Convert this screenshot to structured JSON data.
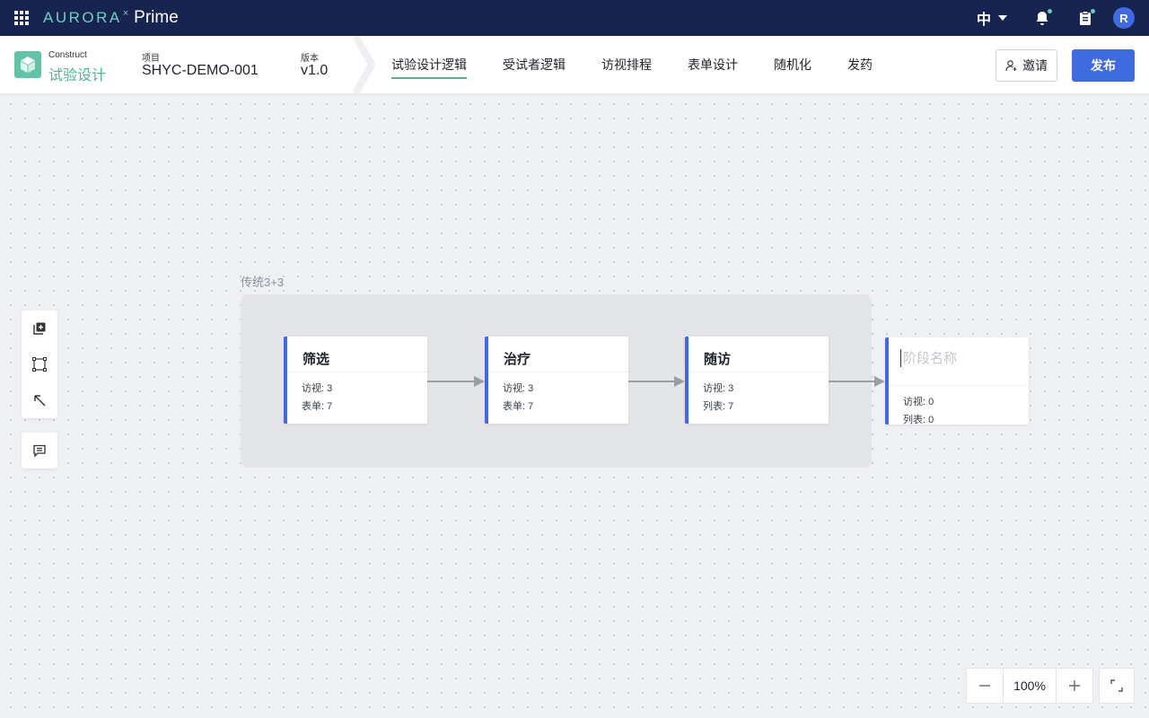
{
  "topbar": {
    "brand_name": "AURORA",
    "brand_mark": "×",
    "product_name": "Prime",
    "language": "中",
    "user_initial": "R",
    "icons": [
      "apps-grid-icon",
      "bell-icon",
      "clipboard-icon",
      "avatar"
    ]
  },
  "header": {
    "module_sub": "Construct",
    "module_title": "试验设计",
    "project_label": "项目",
    "project_value": "SHYC-DEMO-001",
    "version_label": "版本",
    "version_value": "v1.0",
    "tabs": [
      {
        "label": "试验设计逻辑",
        "active": true
      },
      {
        "label": "受试者逻辑",
        "active": false
      },
      {
        "label": "访视排程",
        "active": false
      },
      {
        "label": "表单设计",
        "active": false
      },
      {
        "label": "随机化",
        "active": false
      },
      {
        "label": "发药",
        "active": false
      }
    ],
    "invite_label": "邀请",
    "publish_label": "发布"
  },
  "canvas": {
    "group_label": "传统3+3",
    "stages": [
      {
        "name": "筛选",
        "line1": "访视: 3",
        "line2": "表单: 7"
      },
      {
        "name": "治疗",
        "line1": "访视: 3",
        "line2": "表单: 7"
      },
      {
        "name": "随访",
        "line1": "访视: 3",
        "line2": "列表: 7"
      }
    ],
    "new_stage": {
      "placeholder": "阶段名称",
      "line1": "访视: 0",
      "line2": "列表: 0"
    }
  },
  "zoom": {
    "level": "100%"
  },
  "colors": {
    "topbar_bg": "#16244f",
    "accent_teal": "#4fb394",
    "primary_blue": "#3f6ae0"
  }
}
